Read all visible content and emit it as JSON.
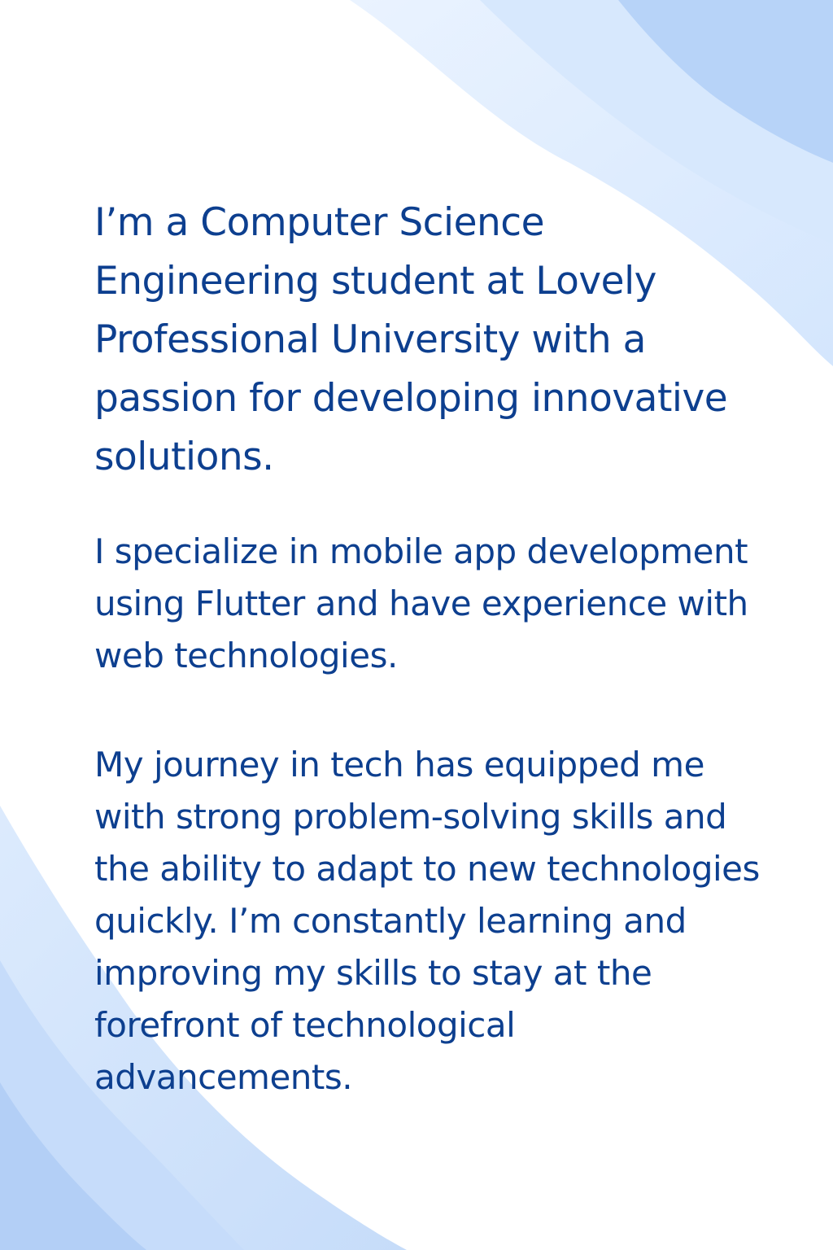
{
  "about": {
    "intro": "I’m a Computer Science Engineering student at Lovely Professional University with a passion for developing innovative solutions.",
    "specialization": "I specialize in mobile app development using Flutter and have experience with web technologies.",
    "journey": "My journey in tech has equipped me with strong problem-solving skills and the ability to adapt to new technologies quickly. I’m constantly learning and improving my skills to stay at the forefront of technological advancements."
  },
  "colors": {
    "text": "#0d3f8f",
    "background": "#ffffff",
    "wave_light": "#e3efff",
    "wave_mid": "#cfe2fd",
    "wave_dark": "#b3d0f6"
  }
}
